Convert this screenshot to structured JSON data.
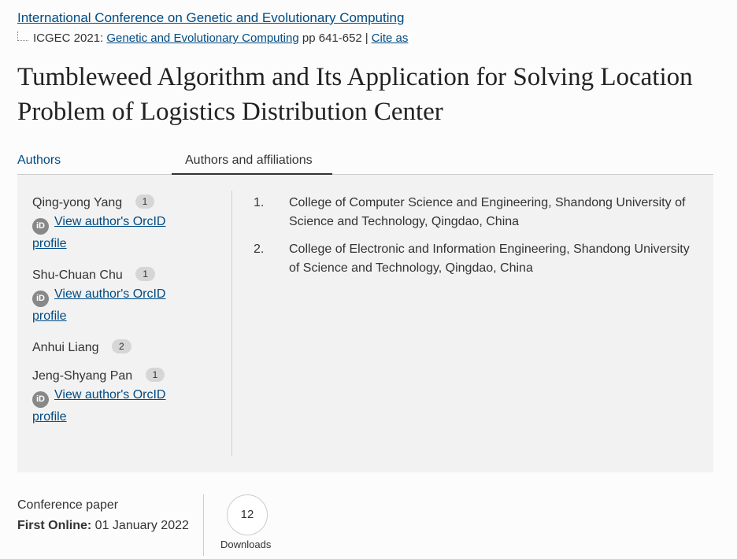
{
  "header": {
    "conference_link": "International Conference on Genetic and Evolutionary Computing",
    "proceedings_prefix": "ICGEC 2021: ",
    "proceedings_link": "Genetic and Evolutionary Computing",
    "pages": "pp 641-652",
    "separator": "|",
    "cite_link": "Cite as"
  },
  "title": "Tumbleweed Algorithm and Its Application for Solving Location Problem of Logistics Distribution Center",
  "tabs": {
    "authors": "Authors",
    "affiliations": "Authors and affiliations"
  },
  "authors": [
    {
      "name": "Qing-yong Yang",
      "aff": "1",
      "orcid_link": "View author's OrcID",
      "orcid_link2": "profile"
    },
    {
      "name": "Shu-Chuan Chu",
      "aff": "1",
      "orcid_link": "View author's OrcID",
      "orcid_link2": "profile"
    },
    {
      "name": "Anhui Liang",
      "aff": "2"
    },
    {
      "name": "Jeng-Shyang Pan",
      "aff": "1",
      "orcid_link": "View author's OrcID",
      "orcid_link2": "profile"
    }
  ],
  "orcid_icon_text": "iD",
  "affiliations": [
    {
      "num": "1.",
      "text": "College of Computer Science and Engineering, Shandong University of Science and Technology, Qingdao, China"
    },
    {
      "num": "2.",
      "text": "College of Electronic and Information Engineering, Shandong University of Science and Technology, Qingdao, China"
    }
  ],
  "meta": {
    "type": "Conference paper",
    "first_online_label": "First Online:",
    "first_online_date": " 01 January 2022",
    "downloads_count": "12",
    "downloads_label": "Downloads"
  }
}
